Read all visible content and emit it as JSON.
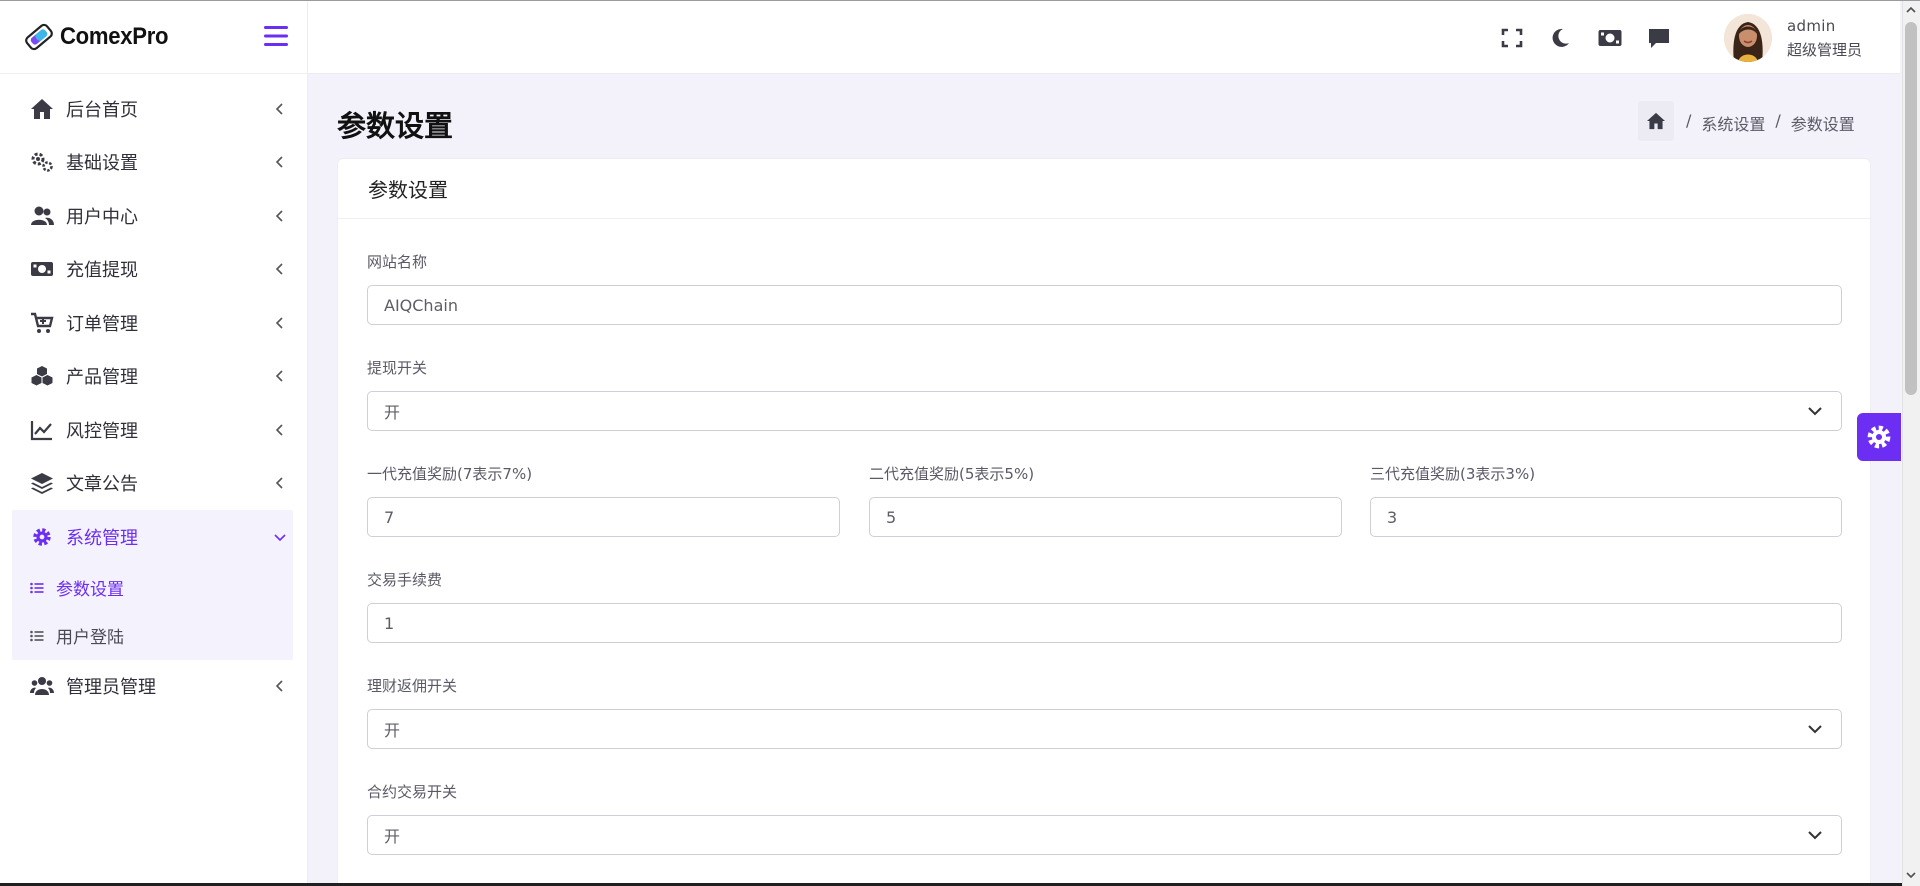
{
  "brand": {
    "name": "ComexPro"
  },
  "sidebar": {
    "items": [
      {
        "label": "后台首页",
        "icon": "home-icon"
      },
      {
        "label": "基础设置",
        "icon": "cogs-icon"
      },
      {
        "label": "用户中心",
        "icon": "users-icon"
      },
      {
        "label": "充值提现",
        "icon": "money-icon"
      },
      {
        "label": "订单管理",
        "icon": "cart-icon"
      },
      {
        "label": "产品管理",
        "icon": "cubes-icon"
      },
      {
        "label": "风控管理",
        "icon": "line-chart-icon"
      },
      {
        "label": "文章公告",
        "icon": "layers-icon"
      }
    ],
    "active_group": {
      "label": "系统管理",
      "icon": "gear-icon",
      "children": [
        {
          "label": "参数设置",
          "active": true
        },
        {
          "label": "用户登陆",
          "active": false
        }
      ]
    },
    "last_item": {
      "label": "管理员管理",
      "icon": "user-group-icon"
    }
  },
  "header": {
    "icons": [
      "fullscreen-icon",
      "moon-icon",
      "money-icon",
      "message-icon"
    ],
    "user": {
      "name": "admin",
      "role": "超级管理员"
    }
  },
  "page": {
    "title": "参数设置",
    "breadcrumb": [
      "系统设置",
      "参数设置"
    ]
  },
  "card": {
    "title": "参数设置",
    "fields": {
      "site_name": {
        "label": "网站名称",
        "value": "AIQChain"
      },
      "withdraw_switch": {
        "label": "提现开关",
        "value": "开"
      },
      "reward_1": {
        "label": "一代充值奖励(7表示7%)",
        "value": "7"
      },
      "reward_2": {
        "label": "二代充值奖励(5表示5%)",
        "value": "5"
      },
      "reward_3": {
        "label": "三代充值奖励(3表示3%)",
        "value": "3"
      },
      "trade_fee": {
        "label": "交易手续费",
        "value": "1"
      },
      "finance_rebate_switch": {
        "label": "理财返佣开关",
        "value": "开"
      },
      "contract_switch": {
        "label": "合约交易开关",
        "value": "开"
      }
    }
  },
  "colors": {
    "accent": "#6c2ef3",
    "background": "#f3f2fa"
  }
}
